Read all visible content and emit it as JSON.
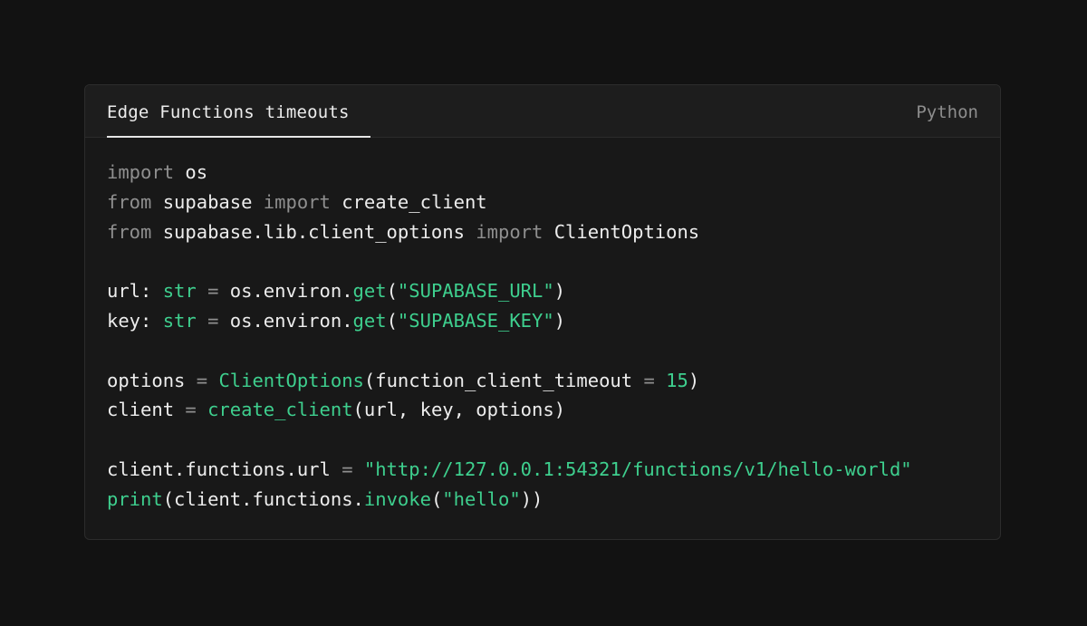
{
  "header": {
    "tab_label": "Edge Functions timeouts",
    "language": "Python"
  },
  "colors": {
    "background": "#121212",
    "card": "#181818",
    "text": "#ededed",
    "keyword": "#8f8f8f",
    "accent_green": "#3ecf8e"
  },
  "code": {
    "lines": [
      [
        {
          "t": "import",
          "k": "kw"
        },
        {
          "t": " os",
          "k": "tx"
        }
      ],
      [
        {
          "t": "from",
          "k": "kw"
        },
        {
          "t": " supabase ",
          "k": "tx"
        },
        {
          "t": "import",
          "k": "kw"
        },
        {
          "t": " create_client",
          "k": "tx"
        }
      ],
      [
        {
          "t": "from",
          "k": "kw"
        },
        {
          "t": " supabase.lib.client_options ",
          "k": "tx"
        },
        {
          "t": "import",
          "k": "kw"
        },
        {
          "t": " ClientOptions",
          "k": "tx"
        }
      ],
      [],
      [
        {
          "t": "url: ",
          "k": "tx"
        },
        {
          "t": "str",
          "k": "fn"
        },
        {
          "t": " = ",
          "k": "op"
        },
        {
          "t": "os.environ.",
          "k": "tx"
        },
        {
          "t": "get",
          "k": "fn"
        },
        {
          "t": "(",
          "k": "tx"
        },
        {
          "t": "\"SUPABASE_URL\"",
          "k": "str"
        },
        {
          "t": ")",
          "k": "tx"
        }
      ],
      [
        {
          "t": "key: ",
          "k": "tx"
        },
        {
          "t": "str",
          "k": "fn"
        },
        {
          "t": " = ",
          "k": "op"
        },
        {
          "t": "os.environ.",
          "k": "tx"
        },
        {
          "t": "get",
          "k": "fn"
        },
        {
          "t": "(",
          "k": "tx"
        },
        {
          "t": "\"SUPABASE_KEY\"",
          "k": "str"
        },
        {
          "t": ")",
          "k": "tx"
        }
      ],
      [],
      [
        {
          "t": "options ",
          "k": "tx"
        },
        {
          "t": "=",
          "k": "op"
        },
        {
          "t": " ",
          "k": "tx"
        },
        {
          "t": "ClientOptions",
          "k": "fn"
        },
        {
          "t": "(function_client_timeout ",
          "k": "tx"
        },
        {
          "t": "=",
          "k": "op"
        },
        {
          "t": " ",
          "k": "tx"
        },
        {
          "t": "15",
          "k": "num"
        },
        {
          "t": ")",
          "k": "tx"
        }
      ],
      [
        {
          "t": "client ",
          "k": "tx"
        },
        {
          "t": "=",
          "k": "op"
        },
        {
          "t": " ",
          "k": "tx"
        },
        {
          "t": "create_client",
          "k": "fn"
        },
        {
          "t": "(url, key, options)",
          "k": "tx"
        }
      ],
      [],
      [
        {
          "t": "client.functions.url ",
          "k": "tx"
        },
        {
          "t": "=",
          "k": "op"
        },
        {
          "t": " ",
          "k": "tx"
        },
        {
          "t": "\"http://127.0.0.1:54321/functions/v1/hello-world\"",
          "k": "str"
        }
      ],
      [
        {
          "t": "print",
          "k": "fn"
        },
        {
          "t": "(client.functions.",
          "k": "tx"
        },
        {
          "t": "invoke",
          "k": "fn"
        },
        {
          "t": "(",
          "k": "tx"
        },
        {
          "t": "\"hello\"",
          "k": "str"
        },
        {
          "t": "))",
          "k": "tx"
        }
      ]
    ]
  }
}
